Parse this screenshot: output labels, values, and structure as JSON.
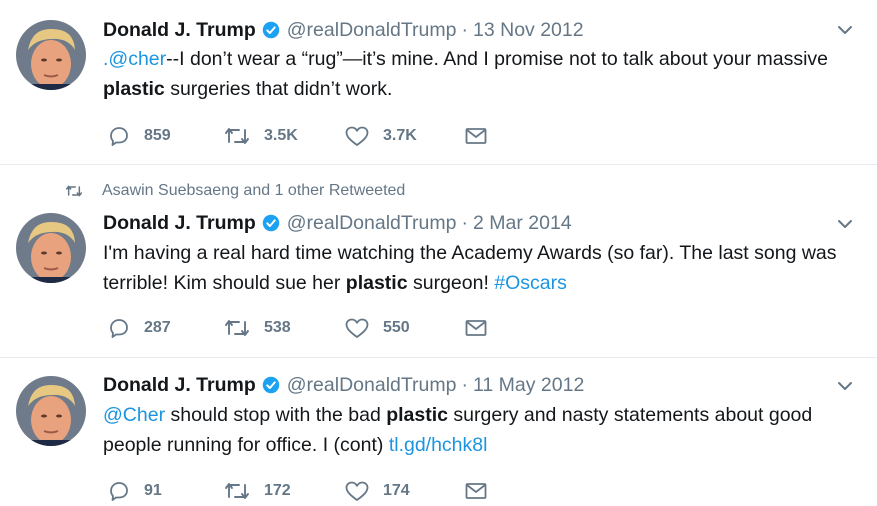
{
  "colors": {
    "link": "#1b95e0",
    "secondary": "#657786",
    "text": "#14171a",
    "verified": "#1da1f2",
    "divider": "#e6ecf0"
  },
  "tweets": [
    {
      "author": "Donald J. Trump",
      "handle": "@realDonaldTrump",
      "separator": "·",
      "date": "13 Nov 2012",
      "text": {
        "link1": ".@cher",
        "part1": "--I don’t wear a “rug”—it’s mine. And I promise not to talk about your massive ",
        "bold": "plastic",
        "part2": " surgeries that didn’t work."
      },
      "replies": "859",
      "retweets": "3.5K",
      "likes": "3.7K"
    },
    {
      "retweet_context": "Asawin Suebsaeng and 1 other Retweeted",
      "author": "Donald J. Trump",
      "handle": "@realDonaldTrump",
      "separator": "·",
      "date": "2 Mar 2014",
      "text": {
        "part1": "I'm having a real hard time watching the Academy Awards (so far). The last song was terrible! Kim should sue her ",
        "bold": "plastic",
        "part2": " surgeon! ",
        "hashtag": "#Oscars"
      },
      "replies": "287",
      "retweets": "538",
      "likes": "550"
    },
    {
      "author": "Donald J. Trump",
      "handle": "@realDonaldTrump",
      "separator": "·",
      "date": "11 May 2012",
      "text": {
        "link1": "@Cher",
        "part1": " should stop with the bad ",
        "bold": "plastic",
        "part2": " surgery and nasty statements about good people running for office. I (cont) ",
        "url": "tl.gd/hchk8l"
      },
      "replies": "91",
      "retweets": "172",
      "likes": "174"
    }
  ],
  "icons": {
    "reply": "reply-icon",
    "retweet": "retweet-icon",
    "like": "heart-icon",
    "dm": "envelope-icon",
    "caret": "chevron-down-icon",
    "verified": "verified-badge-icon"
  }
}
